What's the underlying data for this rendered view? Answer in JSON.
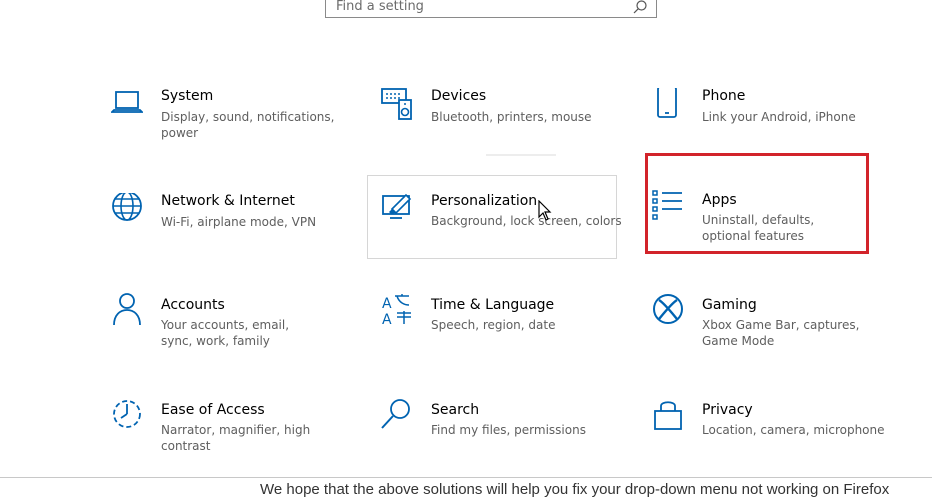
{
  "search": {
    "placeholder": "Find a setting"
  },
  "tiles": [
    {
      "id": "system",
      "title": "System",
      "desc": "Display, sound, notifications, power",
      "icon": "laptop-icon"
    },
    {
      "id": "devices",
      "title": "Devices",
      "desc": "Bluetooth, printers, mouse",
      "icon": "devices-icon"
    },
    {
      "id": "phone",
      "title": "Phone",
      "desc": "Link your Android, iPhone",
      "icon": "phone-icon"
    },
    {
      "id": "network",
      "title": "Network & Internet",
      "desc": "Wi-Fi, airplane mode, VPN",
      "icon": "globe-icon"
    },
    {
      "id": "personalization",
      "title": "Personalization",
      "desc": "Background, lock screen, colors",
      "icon": "paint-icon"
    },
    {
      "id": "apps",
      "title": "Apps",
      "desc": "Uninstall, defaults, optional features",
      "icon": "apps-list-icon"
    },
    {
      "id": "accounts",
      "title": "Accounts",
      "desc": "Your accounts, email, sync, work, family",
      "icon": "person-icon"
    },
    {
      "id": "time",
      "title": "Time & Language",
      "desc": "Speech, region, date",
      "icon": "time-language-icon"
    },
    {
      "id": "gaming",
      "title": "Gaming",
      "desc": "Xbox Game Bar, captures, Game Mode",
      "icon": "xbox-icon"
    },
    {
      "id": "ease",
      "title": "Ease of Access",
      "desc": "Narrator, magnifier, high contrast",
      "icon": "ease-of-access-icon"
    },
    {
      "id": "search",
      "title": "Search",
      "desc": "Find my files, permissions",
      "icon": "magnifier-icon"
    },
    {
      "id": "privacy",
      "title": "Privacy",
      "desc": "Location, camera, microphone",
      "icon": "lock-icon"
    }
  ],
  "footer": {
    "text": "We hope that the above solutions will help you fix your drop-down menu not working on Firefox"
  },
  "colors": {
    "accent": "#0063b1",
    "highlight": "#d2232a"
  }
}
